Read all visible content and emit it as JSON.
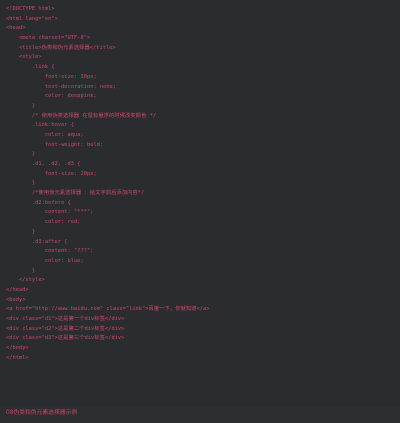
{
  "code": {
    "lines": [
      "<!DOCTYPE html>",
      "<html lang=\"en\">",
      "<head>",
      "    <meta charset=\"UTF-8\">",
      "    <title>伪类和伪元素选择器</title>",
      "    <style>",
      "        .link {",
      "            font-size: 30px;",
      "            text-decoration: none;",
      "            color: deeppink;",
      "        }",
      "        /* 使用伪类选择器 在鼠标悬浮的时候改变颜色 */",
      "        .link:hover {",
      "            color: aqua;",
      "            font-weight: bold;",
      "        }",
      "        .d1, .d2, .d3 {",
      "            font-size: 20px;",
      "        }",
      "        /*使用伪元素选择器 ：给文字前后添加内容*/",
      "        .d2:before {",
      "            content: \"***\";",
      "            color: red;",
      "        }",
      "        .d3:after {",
      "            content: \"???\";",
      "            color: blue;",
      "        }",
      "    </style>",
      "</head>",
      "<body>",
      "<a href=\"http://www.baidu.com\" class=\"link\">百度一下，你就知道</a>",
      "<div class=\"d1\">这是第一个div标签</div>",
      "<div class=\"d2\">这是第二个div标签</div>",
      "<div class=\"d3\">这是第三个div标签</div>",
      "</body>",
      "</html>"
    ]
  },
  "caption": "08伪类和伪元素选择器示例",
  "colors": {
    "background": "#2c2e31",
    "code_text": "#d04a6a"
  }
}
